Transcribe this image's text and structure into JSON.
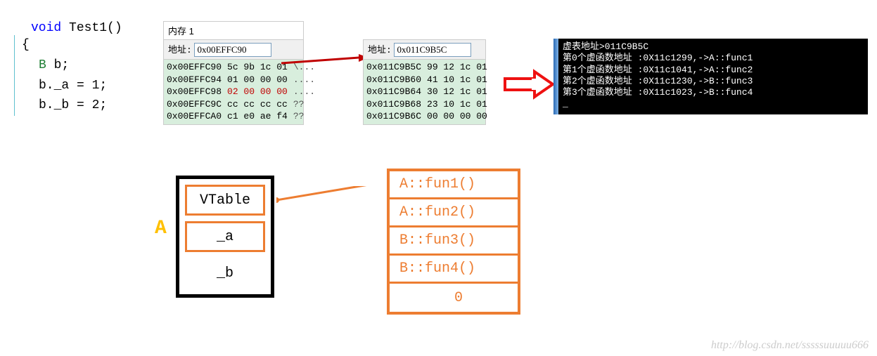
{
  "code": {
    "signature": "void Test1()",
    "open_brace": "{",
    "l1": "B b;",
    "l2": "b._a = 1;",
    "l3": "b._b = 2;"
  },
  "mem1": {
    "tab": "内存 1",
    "addr_label": "地址:",
    "addr_value": "0x00EFFC90",
    "rows": [
      {
        "a": "0x00EFFC90",
        "b": "5c 9b 1c 01",
        "c": "\\..."
      },
      {
        "a": "0x00EFFC94",
        "b": "01 00 00 00",
        "c": "...."
      },
      {
        "a": "0x00EFFC98",
        "b": "02 00 00 00",
        "c": "....",
        "red": true
      },
      {
        "a": "0x00EFFC9C",
        "b": "cc cc cc cc",
        "c": "??"
      },
      {
        "a": "0x00EFFCA0",
        "b": "c1 e0 ae f4",
        "c": "??"
      }
    ]
  },
  "mem2": {
    "addr_label": "地址:",
    "addr_value": "0x011C9B5C",
    "rows": [
      {
        "a": "0x011C9B5C",
        "b": "99 12 1c 01",
        "c": ""
      },
      {
        "a": "0x011C9B60",
        "b": "41 10 1c 01",
        "c": ""
      },
      {
        "a": "0x011C9B64",
        "b": "30 12 1c 01",
        "c": ""
      },
      {
        "a": "0x011C9B68",
        "b": "23 10 1c 01",
        "c": ""
      },
      {
        "a": "0x011C9B6C",
        "b": "00 00 00 00",
        "c": ""
      }
    ]
  },
  "console": {
    "l0": "虚表地址>011C9B5C",
    "l1": "第0个虚函数地址 :0X11c1299,->A::func1",
    "l2": "第1个虚函数地址 :0X11c1041,->A::func2",
    "l3": "第2个虚函数地址 :0X11c1230,->B::func3",
    "l4": "第3个虚函数地址 :0X11c1023,->B::func4"
  },
  "diagram": {
    "label_A": "A",
    "obj": {
      "vtable": "VTable",
      "a": "_a",
      "b": "_b"
    },
    "vt": [
      "A::fun1()",
      "A::fun2()",
      "B::fun3()",
      "B::fun4()",
      "0"
    ]
  },
  "watermark": "http://blog.csdn.net/sssssuuuuu666"
}
